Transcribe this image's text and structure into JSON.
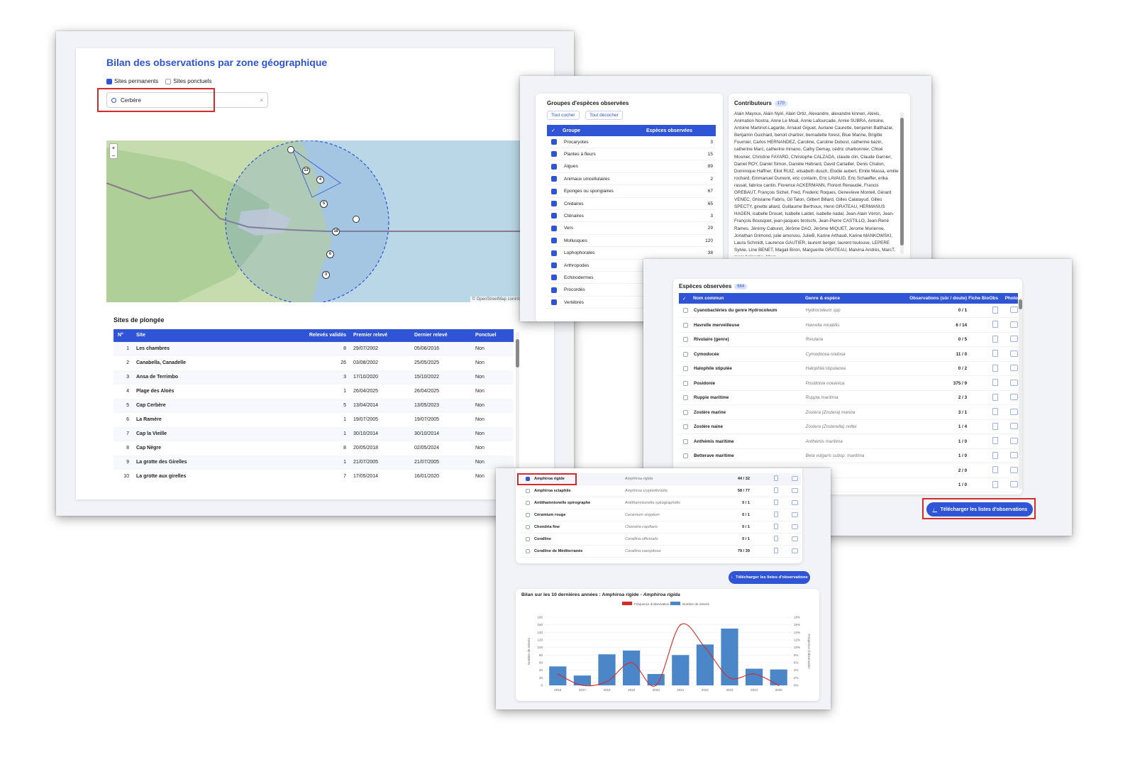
{
  "main": {
    "title": "Bilan des observations par zone géographique",
    "filters": [
      {
        "label": "Sites permanents",
        "checked": true
      },
      {
        "label": "Sites ponctuels",
        "checked": false
      }
    ],
    "search": {
      "value": "Cerbère",
      "clear": "×"
    },
    "map": {
      "zoom_in": "+",
      "zoom_out": "−",
      "attribution": "© OpenStreetMap contributors",
      "markers": [
        "13",
        "4",
        "5",
        "18",
        "6",
        "3"
      ]
    }
  },
  "sites": {
    "title": "Sites de plongée",
    "columns": [
      "N°",
      "Site",
      "Relevés validés",
      "Premier relevé",
      "Dernier relevé",
      "Ponctuel"
    ],
    "rows": [
      [
        "1",
        "Les chambres",
        "8",
        "29/07/2002",
        "05/06/2016",
        "Non"
      ],
      [
        "2",
        "Canabella, Canadelle",
        "26",
        "03/08/2002",
        "25/05/2025",
        "Non"
      ],
      [
        "3",
        "Ansa de Terrimbo",
        "3",
        "17/10/2020",
        "15/10/2022",
        "Non"
      ],
      [
        "4",
        "Plage des Aloès",
        "1",
        "26/04/2025",
        "26/04/2025",
        "Non"
      ],
      [
        "5",
        "Cap Cerbère",
        "5",
        "13/04/2014",
        "13/05/2023",
        "Non"
      ],
      [
        "6",
        "La Ramère",
        "1",
        "19/07/2005",
        "19/07/2005",
        "Non"
      ],
      [
        "7",
        "Cap la Vieille",
        "1",
        "30/10/2014",
        "30/10/2014",
        "Non"
      ],
      [
        "8",
        "Cap Nègre",
        "8",
        "20/05/2018",
        "02/05/2024",
        "Non"
      ],
      [
        "9",
        "La grotte des Girelles",
        "1",
        "21/07/2005",
        "21/07/2005",
        "Non"
      ],
      [
        "10",
        "La grotte aux girelles",
        "7",
        "17/05/2014",
        "16/01/2020",
        "Non"
      ]
    ]
  },
  "groups": {
    "title": "Groupes d'espèces observées",
    "check_all": "Tout cocher",
    "uncheck_all": "Tout décocher",
    "columns": [
      "✓",
      "Groupe",
      "Espèces observées"
    ],
    "rows": [
      [
        "Procaryotes",
        "3"
      ],
      [
        "Plantes à fleurs",
        "15"
      ],
      [
        "Algues",
        "89"
      ],
      [
        "Animaux unicellulaires",
        "2"
      ],
      [
        "Eponges ou spongiaires",
        "67"
      ],
      [
        "Cnidaires",
        "65"
      ],
      [
        "Cténaires",
        "3"
      ],
      [
        "Vers",
        "29"
      ],
      [
        "Mollusques",
        "120"
      ],
      [
        "Lophophorates",
        "38"
      ],
      [
        "Arthropodes",
        ""
      ],
      [
        "Echinodermes",
        ""
      ],
      [
        "Procordés",
        ""
      ],
      [
        "Vertébrés",
        ""
      ]
    ]
  },
  "contributors": {
    "title": "Contributeurs",
    "count": "170",
    "text": "Alain Mayoux, Alain Nyiri, Alain Ortiz, Alexandre, alexandre kinnen, Alexis, Animation Nostra, Anne Le Moal, Annie Lafourcade, Annie SUBRA, Antoine, Antoine Martinot-Lagarde, Arnaud Giguet, Auriane Caurette, benjamin Balthazar, Benjamin Guichard, benoit chartrer, bernadette forest, Blue Marine, Brigitte Fournier, Carlos HERNANDEZ, Caroline, Caroline Dubost, catherine bazin, catherine Marc, catherine minano, Cathy Demay, cédric charbonnier, Chloé Mosnier, Christine FAYARD, Christophe CALZADA, claude clin, Claude Garnier, Daniel ROY, Daniel Simon, Danièle Hebrard, David Cartailler, Denis Chaton, Dominique Haffner, Eliot RUIZ, elisabeth dusch, Elodie aubert, Emile Massa, emilie rochard, Emmanuel Dumont, eric contarin, Eric LAVAUD, Eric Schaeffer, erika rassat, fabrice cantin, Florence ACKERMANN, Florent Renaudie, Francis GREBAUT, François Sichel, Fred, Frederic Roques, Genevieve Monteil, Gérard VENEC, Ghislaine Fabris, Gil Talon, Gilbert Billard, Gilles Calatayud, Gilles SPECTY, ginette allard, Guillaume Berthoux, Henri GRATEAU, HERMANUS HAGEN, isabelle Drouet, Isabelle Laidet, isabelle nadal, Jean-Alain Véron, Jean-François Bousquet, jean-jacques brotschi, Jean-Pierre CASTILLO, Jean-René Rames, Jérémy Caburet, Jérôme DAO, Jérôme MIQUET, Jerome Murienne, Jonathan Grimond, julie amoruso, JulieB, Karine Arthaud, Karine MANKOWSKI, Laura Schmidt, Laurence GAUTIER, laurent berger, laurent toulouse, LEPERE Sylvie, Line BENET, Magali Biron, Marguerite GRATEAU, Malvina Andrès, MarcT, marc balanche, Marc"
  },
  "species": {
    "title": "Espèces observées",
    "count": "664",
    "columns": [
      "✓",
      "Nom commun",
      "Genre & espèce",
      "Observations (sûr / doute)",
      "Fiche BioObs",
      "Photo"
    ],
    "rows": [
      [
        "Cyanobactéries du genre Hydrocoleum",
        "Hydrocoleum spp",
        "0 / 1"
      ],
      [
        "Havrelle merveilleuse",
        "Havrella mirabilis",
        "6 / 14"
      ],
      [
        "Rivulaire (genre)",
        "Rivularia",
        "0 / 5"
      ],
      [
        "Cymodocée",
        "Cymodocea nodosa",
        "11 / 0"
      ],
      [
        "Halophile stipulée",
        "Halophila stipulacea",
        "0 / 2"
      ],
      [
        "Posidonie",
        "Posidonia oceanica",
        "375 / 9"
      ],
      [
        "Ruppie maritime",
        "Ruppia maritima",
        "2 / 3"
      ],
      [
        "Zostère marine",
        "Zostera (Zostera) marina",
        "3 / 1"
      ],
      [
        "Zostère naine",
        "Zostera (Zosterella) noltei",
        "1 / 4"
      ],
      [
        "Anthémis maritime",
        "Anthemis maritima",
        "1 / 0"
      ],
      [
        "Betterave maritime",
        "Beta vulgaris subsp. maritima",
        "1 / 0"
      ],
      [
        "",
        "",
        "2 / 0"
      ],
      [
        "",
        "",
        "1 / 0"
      ]
    ],
    "download": "Télécharger les listes d'observations"
  },
  "detail": {
    "rows": [
      [
        "Amphiroa rigide",
        "Amphiroa rigida",
        "44 / 32",
        true
      ],
      [
        "Amphiroa sciaphile",
        "Amphiroa cryptarthrodia",
        "58 / 77",
        false
      ],
      [
        "Antithamnionelle spirographe",
        "Antithamnionella spirographidis",
        "0 / 1",
        false
      ],
      [
        "Céramium rouge",
        "Ceramium virgatum",
        "0 / 1",
        false
      ],
      [
        "Chondria fine",
        "Chondria capillaris",
        "0 / 1",
        false
      ],
      [
        "Coralline",
        "Corallina officinalis",
        "0 / 1",
        false
      ],
      [
        "Coralline de Méditerranée",
        "Corallina caespitosa",
        "79 / 39",
        false
      ]
    ],
    "download": "Télécharger les listes d'observations",
    "chart_title": "Bilan sur les 10 dernières années : Amphiroa rigide - ",
    "chart_title_italic": "Amphiroa rigida"
  },
  "colors": {
    "accent": "#2f54d6",
    "highlight": "#d42b2b",
    "bar": "#4a86c8",
    "line": "#d42b2b"
  },
  "chart_data": {
    "type": "bar",
    "categories": [
      "2016",
      "2017",
      "2018",
      "2019",
      "2020",
      "2021",
      "2022",
      "2023",
      "2024",
      "2025"
    ],
    "series": [
      {
        "name": "Nombre de relevés",
        "type": "bar",
        "axis": "left",
        "values": [
          50,
          26,
          82,
          92,
          30,
          80,
          108,
          150,
          44,
          42
        ]
      },
      {
        "name": "Fréquence d'observation",
        "type": "line",
        "axis": "right",
        "values": [
          3,
          0,
          1,
          6,
          0,
          16,
          10,
          2,
          3,
          0
        ]
      }
    ],
    "y_left": {
      "label": "Nombre de relevés",
      "ticks": [
        0,
        20,
        40,
        60,
        80,
        100,
        120,
        140,
        160,
        180
      ],
      "lim": [
        0,
        180
      ]
    },
    "y_right": {
      "label": "Fréquence d'observation",
      "ticks": [
        "0%",
        "2%",
        "4%",
        "6%",
        "8%",
        "10%",
        "12%",
        "14%",
        "16%",
        "18%"
      ],
      "lim": [
        0,
        18
      ]
    },
    "legend_position": "top-center"
  }
}
